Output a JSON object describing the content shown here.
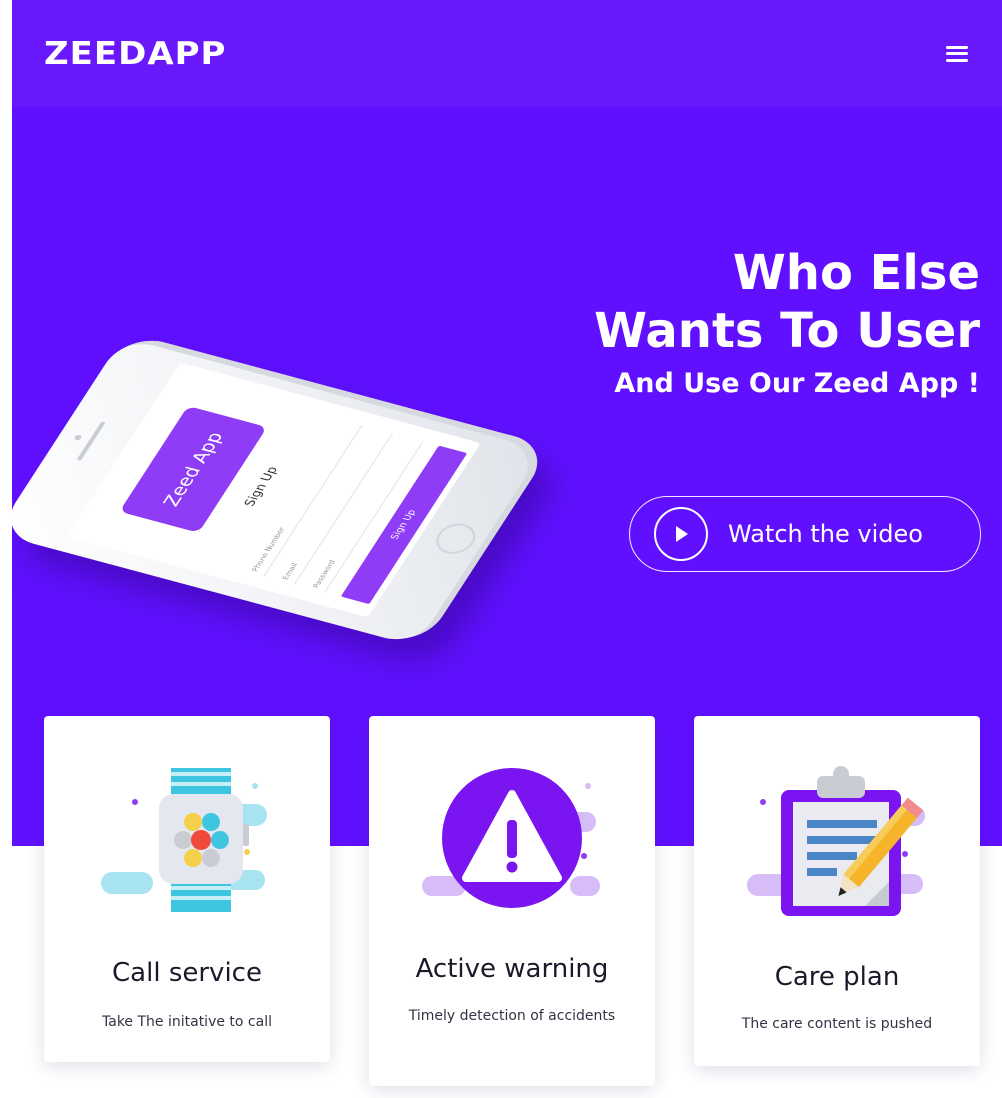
{
  "header": {
    "logo": "ZEEDAPP"
  },
  "hero": {
    "line1": "Who Else",
    "line2": "Wants To User",
    "subtitle": "And Use Our Zeed App !",
    "video_button_label": "Watch the video"
  },
  "phone_screen": {
    "app_card": "Zeed App",
    "title": "Sign Up",
    "field_phone": "Phone Number",
    "field_email": "Email",
    "field_password": "Password",
    "button": "Sign Up"
  },
  "cards": [
    {
      "title": "Call service",
      "description": "Take The initative to call"
    },
    {
      "title": "Active warning",
      "description": "Timely detection of accidents"
    },
    {
      "title": "Care plan",
      "description": "The care content is pushed"
    }
  ],
  "colors": {
    "hero": "#6010ff",
    "header": "#6818fa",
    "accent": "#8e3cf6"
  }
}
